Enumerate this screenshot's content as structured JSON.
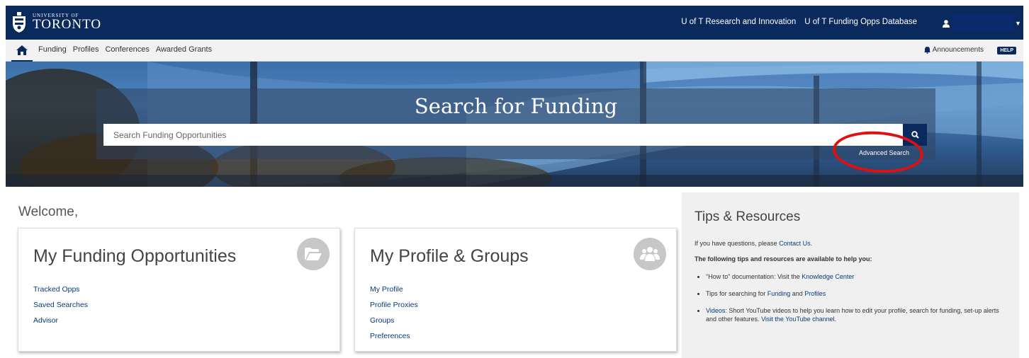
{
  "header": {
    "logo_top": "UNIVERSITY OF",
    "logo_bottom": "TORONTO",
    "links": [
      "U of T Research and Innovation",
      "U of T Funding Opps Database"
    ]
  },
  "nav": {
    "items": [
      "Funding",
      "Profiles",
      "Conferences",
      "Awarded Grants"
    ],
    "announcements": "Announcements",
    "help": "HELP"
  },
  "hero": {
    "title": "Search for Funding",
    "search_placeholder": "Search Funding Opportunities",
    "advanced_search": "Advanced Search"
  },
  "welcome": "Welcome,",
  "cards": [
    {
      "title": "My Funding Opportunities",
      "icon": "folder-open-icon",
      "links": [
        "Tracked Opps",
        "Saved Searches",
        "Advisor"
      ]
    },
    {
      "title": "My Profile & Groups",
      "icon": "users-icon",
      "links": [
        "My Profile",
        "Profile Proxies",
        "Groups",
        "Preferences"
      ]
    }
  ],
  "tips": {
    "title": "Tips & Resources",
    "intro_prefix": "If you have questions, please ",
    "intro_link": "Contact Us",
    "intro_suffix": ".",
    "lead": "The following tips and resources are available to help you:",
    "item1_prefix": "\"How to\" documentation: Visit the ",
    "item1_link": "Knowledge Center",
    "item2_prefix": "Tips for searching for ",
    "item2_link1": "Funding",
    "item2_mid": " and ",
    "item2_link2": "Profiles",
    "item3_link": "Videos",
    "item3_text": ": Short YouTube videos to help you learn how to edit your profile, search for funding, set-up alerts and other features. ",
    "item3_link2": "Visit the YouTube channel",
    "item3_end": "."
  },
  "colors": {
    "brand_navy": "#0a2a5e",
    "link": "#0a3a7a",
    "highlight_circle": "#e01010"
  }
}
